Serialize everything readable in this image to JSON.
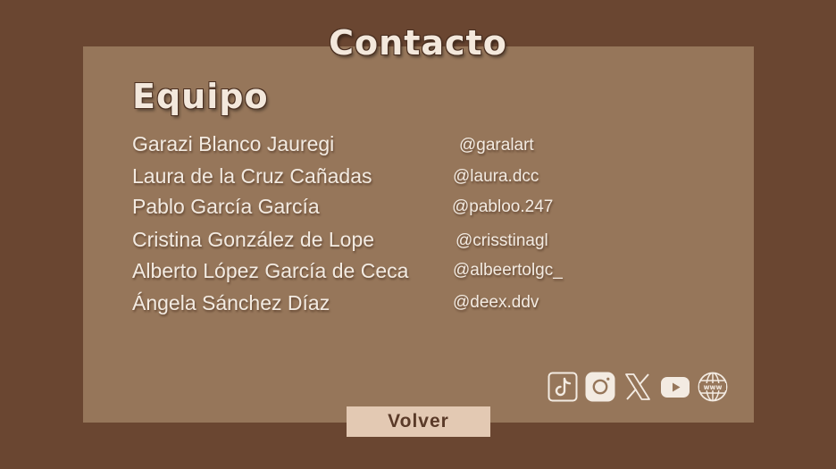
{
  "title": "Contacto",
  "team": {
    "heading": "Equipo",
    "members": [
      {
        "name": "Garazi Blanco Jauregi",
        "handle": "@garalart"
      },
      {
        "name": "Laura de la Cruz Cañadas",
        "handle": "@laura.dcc"
      },
      {
        "name": "Pablo García García",
        "handle": "@pabloo.247"
      },
      {
        "name": "Cristina González de Lope",
        "handle": "@crisstinagl"
      },
      {
        "name": "Alberto López García de Ceca",
        "handle": "@albeertolgc_"
      },
      {
        "name": "Ángela Sánchez Díaz",
        "handle": "@deex.ddv"
      }
    ]
  },
  "socials": [
    {
      "icon": "tiktok-icon"
    },
    {
      "icon": "instagram-icon"
    },
    {
      "icon": "x-icon"
    },
    {
      "icon": "youtube-icon"
    },
    {
      "icon": "website-globe-icon"
    }
  ],
  "back_button": {
    "label": "Volver"
  },
  "colors": {
    "background": "#6a4631",
    "panel": "#96765a",
    "text": "#f3ebe2",
    "button": "#e3c9b3",
    "button_text": "#5a3a28"
  }
}
